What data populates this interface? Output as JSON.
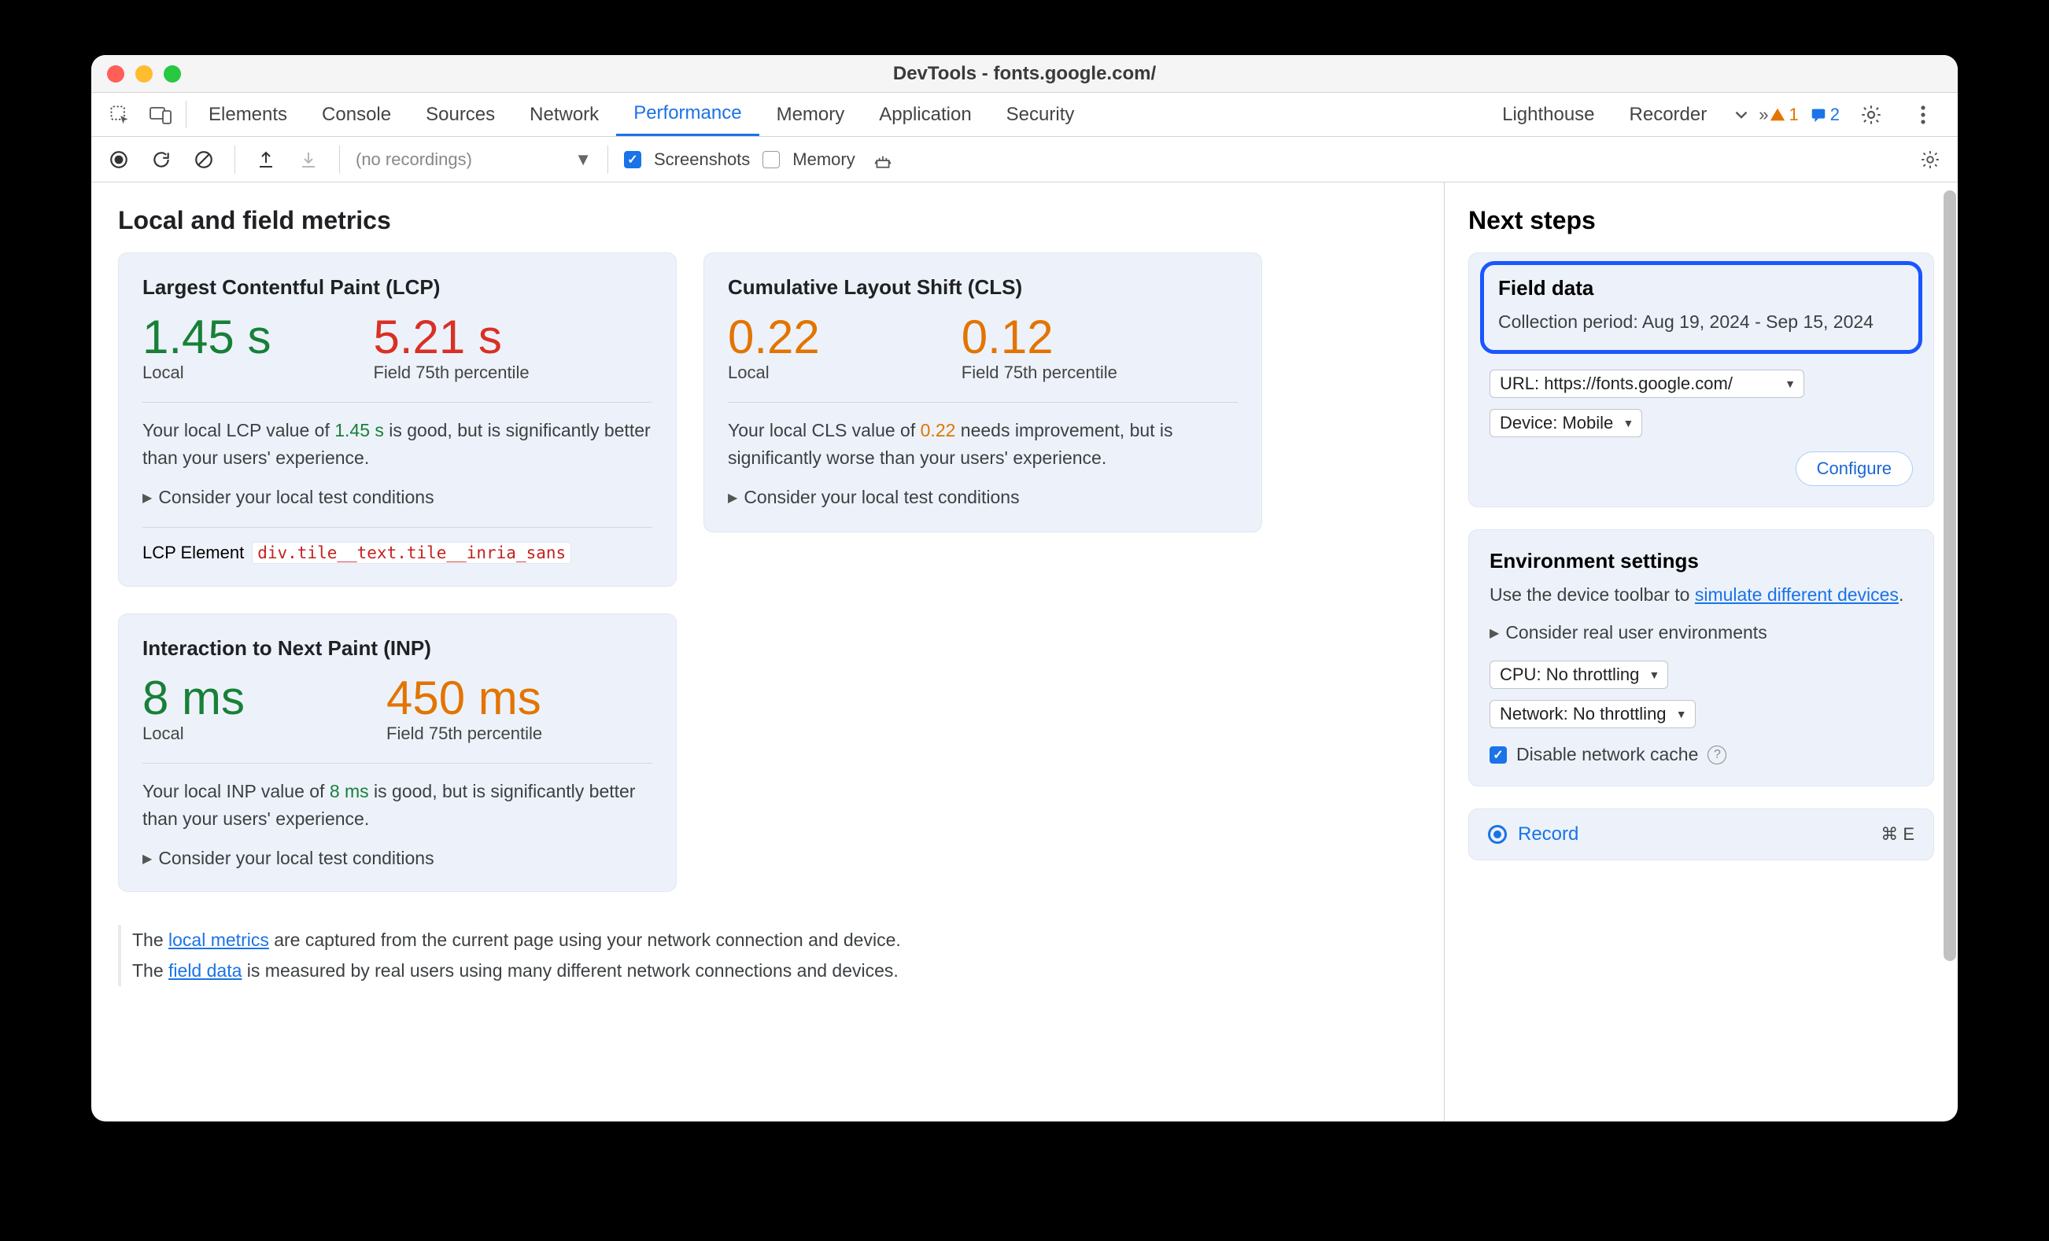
{
  "window": {
    "title": "DevTools - fonts.google.com/"
  },
  "tabs": {
    "items": [
      "Elements",
      "Console",
      "Sources",
      "Network",
      "Performance",
      "Memory",
      "Application",
      "Security",
      "Lighthouse",
      "Recorder"
    ],
    "active": "Performance",
    "warnings_count": "1",
    "messages_count": "2"
  },
  "toolbar": {
    "recordings_placeholder": "(no recordings)",
    "screenshots_label": "Screenshots",
    "memory_label": "Memory",
    "screenshots_checked": true,
    "memory_checked": false
  },
  "main": {
    "heading": "Local and field metrics",
    "lcp": {
      "title": "Largest Contentful Paint (LCP)",
      "local_value": "1.45 s",
      "local_label": "Local",
      "field_value": "5.21 s",
      "field_label": "Field 75th percentile",
      "note_pre": "Your local LCP value of ",
      "note_val": "1.45 s",
      "note_post": " is good, but is significantly better than your users' experience.",
      "disclosure": "Consider your local test conditions",
      "el_label": "LCP Element",
      "el_selector": "div.tile__text.tile__inria_sans"
    },
    "cls": {
      "title": "Cumulative Layout Shift (CLS)",
      "local_value": "0.22",
      "local_label": "Local",
      "field_value": "0.12",
      "field_label": "Field 75th percentile",
      "note_pre": "Your local CLS value of ",
      "note_val": "0.22",
      "note_post": " needs improvement, but is significantly worse than your users' experience.",
      "disclosure": "Consider your local test conditions"
    },
    "inp": {
      "title": "Interaction to Next Paint (INP)",
      "local_value": "8 ms",
      "local_label": "Local",
      "field_value": "450 ms",
      "field_label": "Field 75th percentile",
      "note_pre": "Your local INP value of ",
      "note_val": "8 ms",
      "note_post": " is good, but is significantly better than your users' experience.",
      "disclosure": "Consider your local test conditions"
    },
    "footer": {
      "line1_pre": "The ",
      "line1_link": "local metrics",
      "line1_post": " are captured from the current page using your network connection and device.",
      "line2_pre": "The ",
      "line2_link": "field data",
      "line2_post": " is measured by real users using many different network connections and devices."
    }
  },
  "sidebar": {
    "heading": "Next steps",
    "field_data": {
      "title": "Field data",
      "period_label": "Collection period: ",
      "period_value": "Aug 19, 2024 - Sep 15, 2024",
      "url_label": "URL: ",
      "url_value": "https://fonts.google.com/",
      "device_label": "Device: ",
      "device_value": "Mobile",
      "configure": "Configure"
    },
    "env": {
      "title": "Environment settings",
      "desc_pre": "Use the device toolbar to ",
      "desc_link": "simulate different devices",
      "desc_post": ".",
      "disclosure": "Consider real user environments",
      "cpu_label": "CPU: ",
      "cpu_value": "No throttling",
      "net_label": "Network: ",
      "net_value": "No throttling",
      "cache_label": "Disable network cache"
    },
    "record": {
      "label": "Record",
      "shortcut": "⌘ E"
    }
  }
}
